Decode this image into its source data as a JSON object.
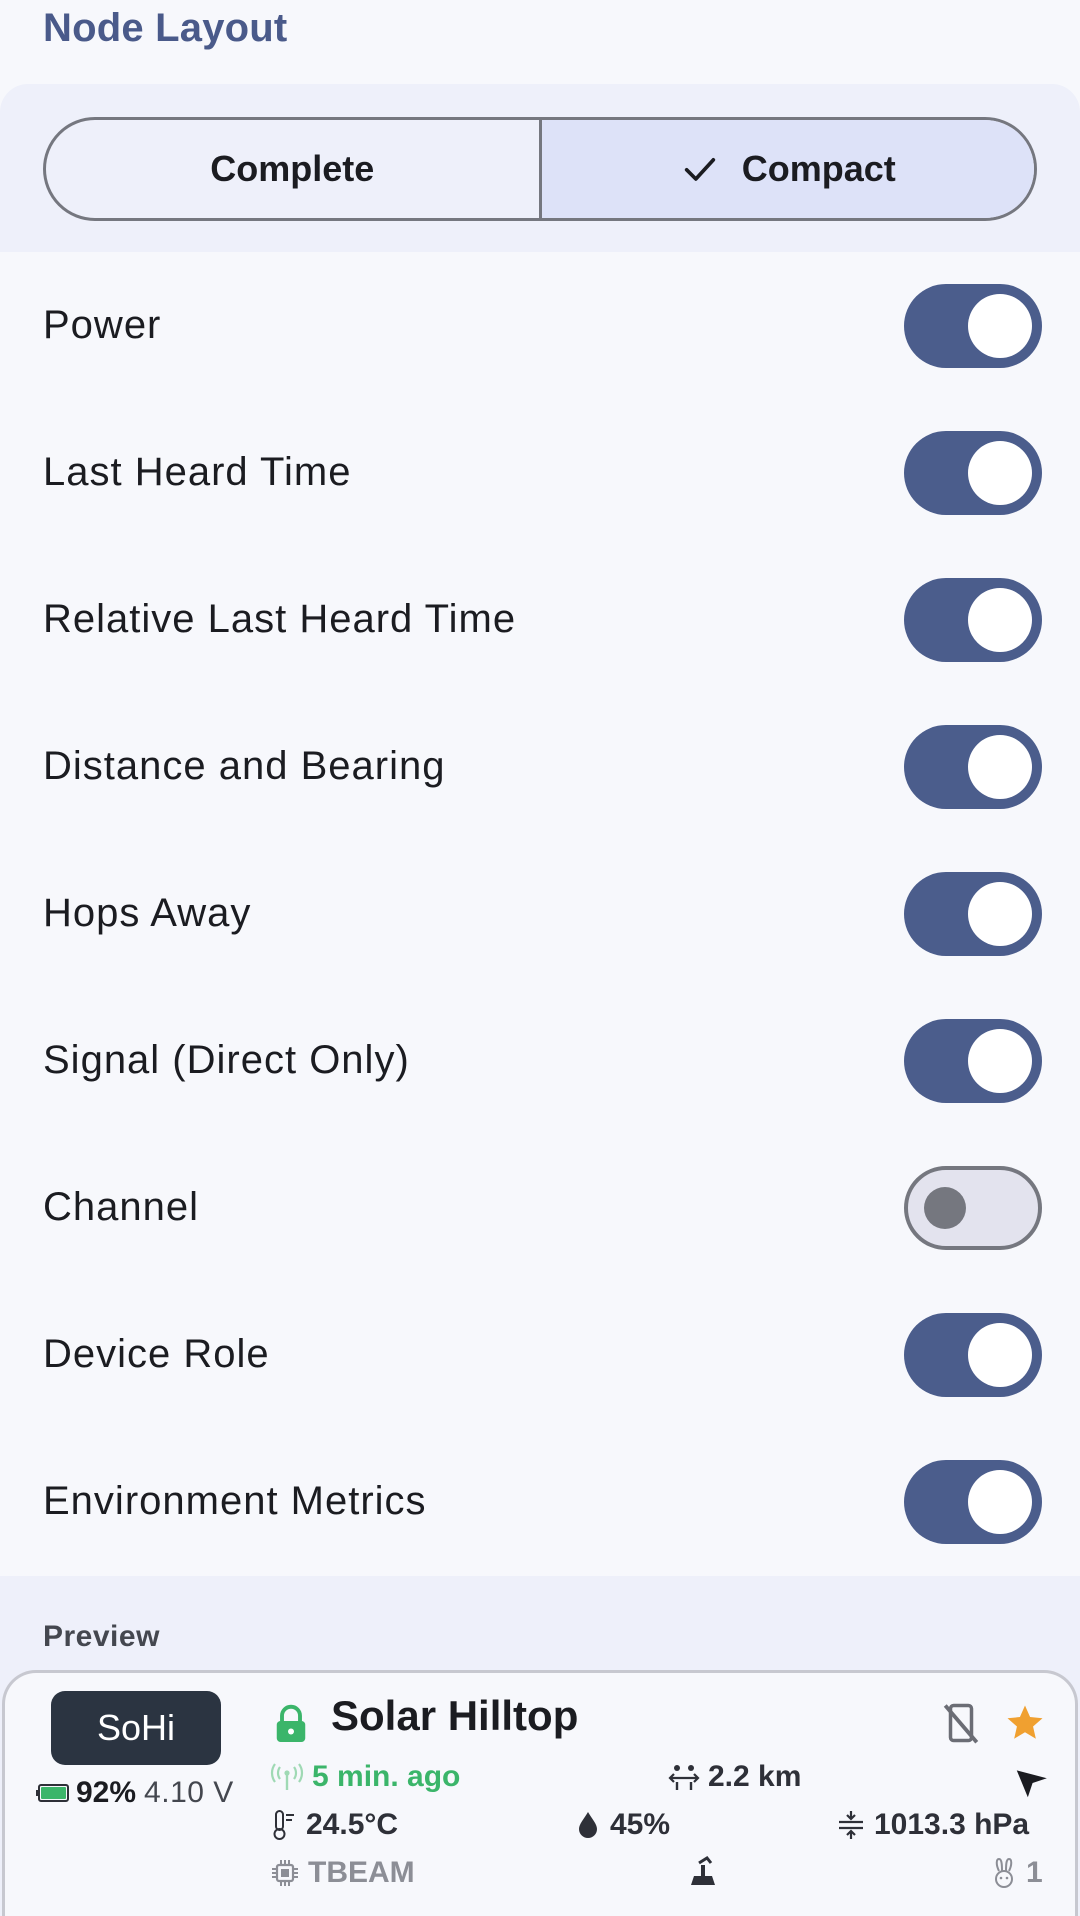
{
  "header": {
    "title": "Node Layout"
  },
  "layout_selector": {
    "options": [
      {
        "label": "Complete",
        "selected": false
      },
      {
        "label": "Compact",
        "selected": true
      }
    ]
  },
  "toggles": [
    {
      "label": "Power",
      "on": true
    },
    {
      "label": "Last Heard Time",
      "on": true
    },
    {
      "label": "Relative Last Heard Time",
      "on": true
    },
    {
      "label": "Distance and Bearing",
      "on": true
    },
    {
      "label": "Hops Away",
      "on": true
    },
    {
      "label": "Signal (Direct Only)",
      "on": true
    },
    {
      "label": "Channel",
      "on": false
    },
    {
      "label": "Device Role",
      "on": true
    },
    {
      "label": "Environment Metrics",
      "on": true
    }
  ],
  "preview": {
    "label": "Preview",
    "node": {
      "short_name": "SoHi",
      "long_name": "Solar Hilltop",
      "battery_percent": "92%",
      "voltage": "4.10 V",
      "last_heard": "5 min. ago",
      "distance": "2.2 km",
      "temperature": "24.5°C",
      "humidity": "45%",
      "pressure": "1013.3 hPa",
      "hardware": "TBEAM",
      "hops": "1"
    },
    "colors": {
      "accent": "#4b5d8c",
      "signal_green": "#3bb56a",
      "star": "#f0a030",
      "badge_bg": "#2b3441"
    }
  }
}
